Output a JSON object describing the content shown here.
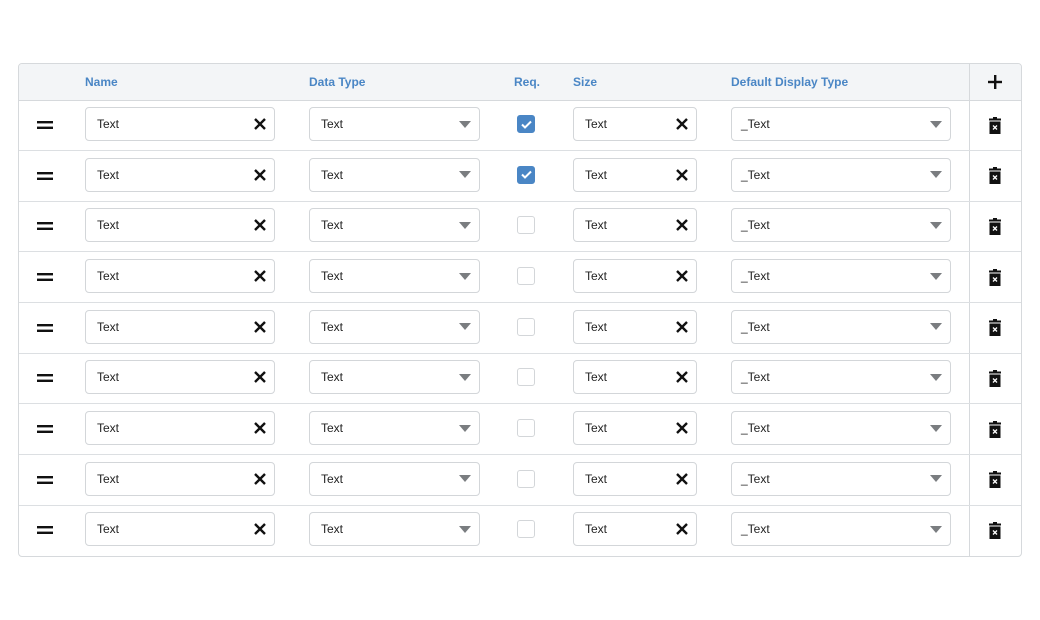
{
  "header": {
    "columns": {
      "name": "Name",
      "data_type": "Data Type",
      "required": "Req.",
      "size": "Size",
      "default_display_type": "Default Display Type"
    },
    "add_icon": "plus-icon"
  },
  "rows": [
    {
      "name": "Text",
      "data_type": "Text",
      "required": true,
      "size": "Text",
      "default_display_type": "_Text"
    },
    {
      "name": "Text",
      "data_type": "Text",
      "required": true,
      "size": "Text",
      "default_display_type": "_Text"
    },
    {
      "name": "Text",
      "data_type": "Text",
      "required": false,
      "size": "Text",
      "default_display_type": "_Text"
    },
    {
      "name": "Text",
      "data_type": "Text",
      "required": false,
      "size": "Text",
      "default_display_type": "_Text"
    },
    {
      "name": "Text",
      "data_type": "Text",
      "required": false,
      "size": "Text",
      "default_display_type": "_Text"
    },
    {
      "name": "Text",
      "data_type": "Text",
      "required": false,
      "size": "Text",
      "default_display_type": "_Text"
    },
    {
      "name": "Text",
      "data_type": "Text",
      "required": false,
      "size": "Text",
      "default_display_type": "_Text"
    },
    {
      "name": "Text",
      "data_type": "Text",
      "required": false,
      "size": "Text",
      "default_display_type": "_Text"
    },
    {
      "name": "Text",
      "data_type": "Text",
      "required": false,
      "size": "Text",
      "default_display_type": "_Text"
    }
  ],
  "icons": {
    "drag": "drag-handle-icon",
    "clear": "clear-x-icon",
    "dropdown": "caret-down-icon",
    "check": "checkmark-icon",
    "delete": "trash-icon"
  },
  "colors": {
    "accent": "#4a86c5",
    "header_bg": "#f3f5f7",
    "border": "#d6d9dc"
  }
}
